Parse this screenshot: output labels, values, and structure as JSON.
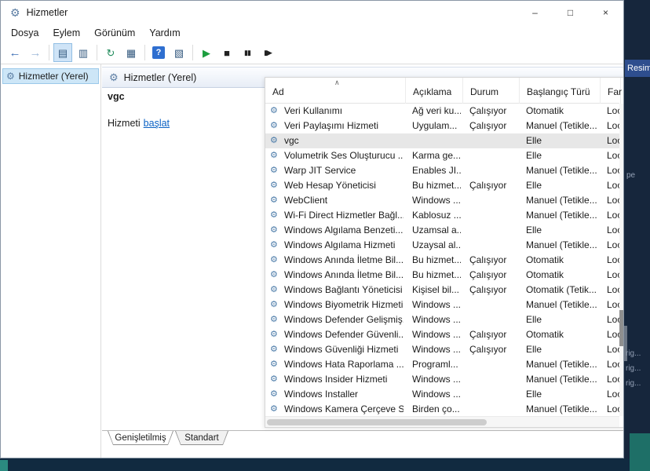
{
  "backdrop": {
    "fragments": {
      "resim": "Resim",
      "pe": "pe",
      "rig1": "rig...",
      "rig2": "rig...",
      "rig3": "rig..."
    }
  },
  "titlebar": {
    "icon": "⚙",
    "title": "Hizmetler",
    "minimize": "–",
    "maximize": "□",
    "close": "×"
  },
  "menubar": {
    "items": [
      {
        "id": "dosya",
        "label": "Dosya"
      },
      {
        "id": "eylem",
        "label": "Eylem"
      },
      {
        "id": "gorunum",
        "label": "Görünüm"
      },
      {
        "id": "yardim",
        "label": "Yardım"
      }
    ]
  },
  "toolbar": {
    "icons": [
      {
        "name": "back-icon",
        "glyph": "←",
        "color": "#3c6eb4"
      },
      {
        "name": "forward-icon",
        "glyph": "→",
        "color": "#9fb9d9"
      },
      {
        "name": "show-console-tree-icon",
        "glyph": "▤",
        "color": "#33587e",
        "selected": true,
        "group_start": true
      },
      {
        "name": "properties-icon",
        "glyph": "▥",
        "color": "#33587e"
      },
      {
        "name": "refresh-icon",
        "glyph": "↻",
        "color": "#1e8a5a",
        "group_start": true
      },
      {
        "name": "export-list-icon",
        "glyph": "▦",
        "color": "#33587e"
      },
      {
        "name": "help-icon",
        "glyph": "?",
        "color": "#ffffff",
        "group_start": true
      },
      {
        "name": "extended-view-icon",
        "glyph": "▧",
        "color": "#33587e"
      },
      {
        "name": "start-service-icon",
        "glyph": "▶",
        "color": "#1d9e3f",
        "group_start": true
      },
      {
        "name": "stop-service-icon",
        "glyph": "■",
        "color": "#222222"
      },
      {
        "name": "pause-service-icon",
        "glyph": "▮▮",
        "color": "#222222"
      },
      {
        "name": "restart-service-icon",
        "glyph": "▮▶",
        "color": "#222222"
      }
    ]
  },
  "tree": {
    "icon": "⚙",
    "root_label": "Hizmetler (Yerel)"
  },
  "main": {
    "header_icon": "⚙",
    "header_label": "Hizmetler (Yerel)",
    "detail": {
      "service_name": "vgc",
      "action_prefix": "Hizmeti",
      "action_link": "başlat"
    },
    "list": {
      "service_icon": "⚙",
      "sort_indicator": "∧",
      "columns": [
        {
          "id": "ad",
          "label": "Ad"
        },
        {
          "id": "aciklama",
          "label": "Açıklama"
        },
        {
          "id": "durum",
          "label": "Durum"
        },
        {
          "id": "baslangic-turu",
          "label": "Başlangıç Türü"
        },
        {
          "id": "farkli",
          "label": "Far"
        }
      ],
      "rows": [
        {
          "name": "Veri Kullanımı",
          "desc": "Ağ veri ku...",
          "status": "Çalışıyor",
          "startup": "Otomatik",
          "logon": "Loc..."
        },
        {
          "name": "Veri Paylaşımı Hizmeti",
          "desc": "Uygulam...",
          "status": "Çalışıyor",
          "startup": "Manuel (Tetikle...",
          "logon": "Loc..."
        },
        {
          "name": "vgc",
          "desc": "",
          "status": "",
          "startup": "Elle",
          "logon": "Loc...",
          "selected": true
        },
        {
          "name": "Volumetrik Ses Oluşturucu ...",
          "desc": "Karma ge...",
          "status": "",
          "startup": "Elle",
          "logon": "Loc..."
        },
        {
          "name": "Warp JIT Service",
          "desc": "Enables JI...",
          "status": "",
          "startup": "Manuel (Tetikle...",
          "logon": "Loc..."
        },
        {
          "name": "Web Hesap Yöneticisi",
          "desc": "Bu hizmet...",
          "status": "Çalışıyor",
          "startup": "Elle",
          "logon": "Loc..."
        },
        {
          "name": "WebClient",
          "desc": "Windows ...",
          "status": "",
          "startup": "Manuel (Tetikle...",
          "logon": "Loc..."
        },
        {
          "name": "Wi-Fi Direct Hizmetler Bağl...",
          "desc": "Kablosuz ...",
          "status": "",
          "startup": "Manuel (Tetikle...",
          "logon": "Loc..."
        },
        {
          "name": "Windows Algılama Benzeti...",
          "desc": "Uzamsal a...",
          "status": "",
          "startup": "Elle",
          "logon": "Loc..."
        },
        {
          "name": "Windows Algılama Hizmeti",
          "desc": "Uzaysal al...",
          "status": "",
          "startup": "Manuel (Tetikle...",
          "logon": "Loc..."
        },
        {
          "name": "Windows Anında İletme Bil...",
          "desc": "Bu hizmet...",
          "status": "Çalışıyor",
          "startup": "Otomatik",
          "logon": "Loc..."
        },
        {
          "name": "Windows Anında İletme Bil...",
          "desc": "Bu hizmet...",
          "status": "Çalışıyor",
          "startup": "Otomatik",
          "logon": "Loc..."
        },
        {
          "name": "Windows Bağlantı Yöneticisi",
          "desc": "Kişisel bil...",
          "status": "Çalışıyor",
          "startup": "Otomatik (Tetik...",
          "logon": "Loc..."
        },
        {
          "name": "Windows Biyometrik Hizmeti",
          "desc": "Windows ...",
          "status": "",
          "startup": "Manuel (Tetikle...",
          "logon": "Loc..."
        },
        {
          "name": "Windows Defender Gelişmiş...",
          "desc": "Windows ...",
          "status": "",
          "startup": "Elle",
          "logon": "Loc..."
        },
        {
          "name": "Windows Defender Güvenli...",
          "desc": "Windows ...",
          "status": "Çalışıyor",
          "startup": "Otomatik",
          "logon": "Loc..."
        },
        {
          "name": "Windows Güvenliği Hizmeti",
          "desc": "Windows ...",
          "status": "Çalışıyor",
          "startup": "Elle",
          "logon": "Loc..."
        },
        {
          "name": "Windows Hata Raporlama ...",
          "desc": "Programl...",
          "status": "",
          "startup": "Manuel (Tetikle...",
          "logon": "Loc..."
        },
        {
          "name": "Windows Insider Hizmeti",
          "desc": "Windows ...",
          "status": "",
          "startup": "Manuel (Tetikle...",
          "logon": "Loc..."
        },
        {
          "name": "Windows Installer",
          "desc": "Windows ...",
          "status": "",
          "startup": "Elle",
          "logon": "Loc..."
        },
        {
          "name": "Windows Kamera Çerçeve S...",
          "desc": "Birden ço...",
          "status": "",
          "startup": "Manuel (Tetikle...",
          "logon": "Loc..."
        }
      ]
    },
    "tabs": [
      {
        "id": "genisletilmis",
        "label": "Genişletilmiş",
        "active": true
      },
      {
        "id": "standart",
        "label": "Standart",
        "active": false
      }
    ]
  }
}
